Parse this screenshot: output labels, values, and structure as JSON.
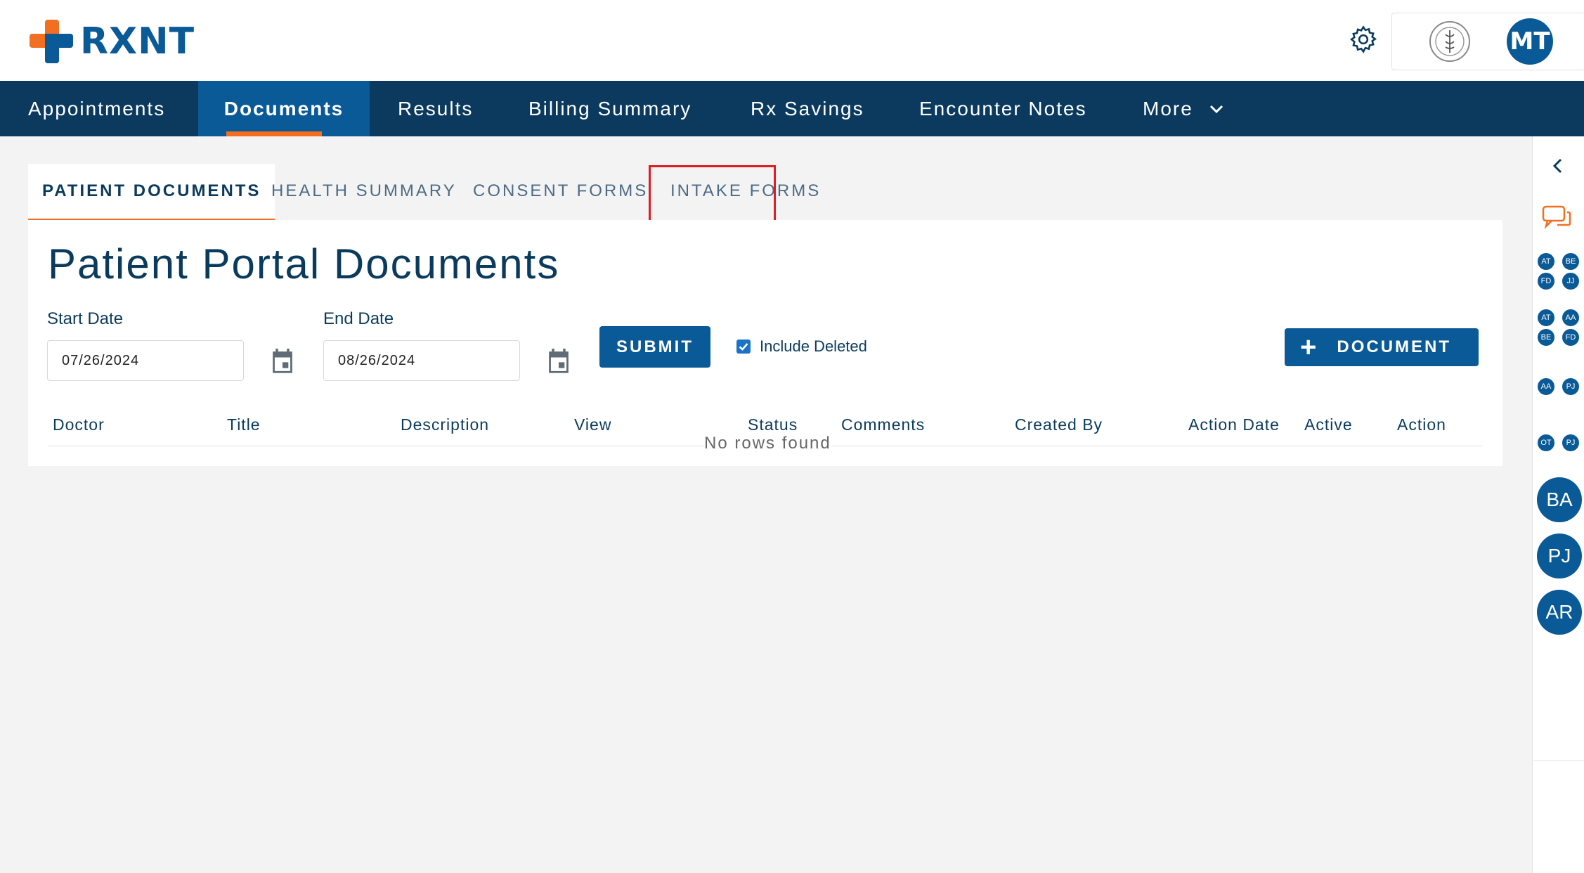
{
  "brand": {
    "name": "RXNT",
    "primary": "#0a5a97",
    "accent": "#f26f21",
    "nav_bg": "#0b3a5e"
  },
  "header": {
    "user_initials": "MT"
  },
  "nav": {
    "items": [
      {
        "label": "Appointments"
      },
      {
        "label": "Documents"
      },
      {
        "label": "Results"
      },
      {
        "label": "Billing Summary"
      },
      {
        "label": "Rx Savings"
      },
      {
        "label": "Encounter Notes"
      },
      {
        "label": "More"
      }
    ],
    "active": "Documents"
  },
  "tabs": {
    "items": [
      {
        "label": "PATIENT DOCUMENTS"
      },
      {
        "label": "HEALTH SUMMARY"
      },
      {
        "label": "CONSENT FORMS"
      },
      {
        "label": "INTAKE FORMS"
      }
    ],
    "active": "PATIENT DOCUMENTS",
    "highlighted": "INTAKE FORMS"
  },
  "page": {
    "title": "Patient Portal Documents",
    "start_date_label": "Start Date",
    "start_date_value": "07/26/2024",
    "end_date_label": "End Date",
    "end_date_value": "08/26/2024",
    "submit_label": "SUBMIT",
    "include_deleted_label": "Include Deleted",
    "include_deleted_checked": true,
    "add_document_label": "DOCUMENT"
  },
  "table": {
    "columns": [
      "Doctor",
      "Title",
      "Description",
      "View",
      "Status",
      "Comments",
      "Created By",
      "Action Date",
      "Active",
      "Action"
    ],
    "empty_text": "No rows found"
  },
  "rail": {
    "groups": [
      [
        "AT",
        "BE",
        "FD",
        "JJ"
      ],
      [
        "AT",
        "AA",
        "BE",
        "FD"
      ],
      [
        "AA",
        "PJ"
      ],
      [
        "OT",
        "PJ"
      ]
    ],
    "avatars": [
      "BA",
      "PJ",
      "AR"
    ]
  }
}
